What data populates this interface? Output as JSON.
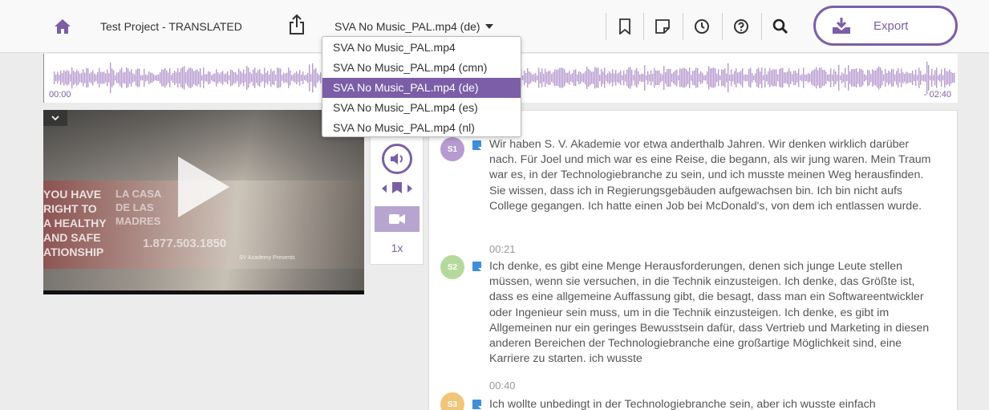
{
  "header": {
    "project_title": "Test Project - TRANSLATED",
    "file_selected": "SVA No Music_PAL.mp4 (de)",
    "export_label": "Export",
    "icons": [
      "home-icon",
      "share-icon",
      "bookmark-icon",
      "note-icon",
      "clock-icon",
      "help-icon",
      "search-icon",
      "download-icon"
    ]
  },
  "dropdown": {
    "options": [
      "SVA No Music_PAL.mp4",
      "SVA No Music_PAL.mp4 (cmn)",
      "SVA No Music_PAL.mp4 (de)",
      "SVA No Music_PAL.mp4 (es)",
      "SVA No Music_PAL.mp4 (nl)"
    ],
    "selected_index": 2
  },
  "waveform": {
    "start_time": "00:00",
    "end_time": "- 02:40",
    "color": "#b79bd0"
  },
  "video": {
    "bus_text": [
      "YOU HAVE",
      "RIGHT TO",
      "A HEALTHY",
      "AND SAFE",
      "ATIONSHIP"
    ],
    "bus_text_2": [
      "LA CASA",
      "DE LAS",
      "MADRES"
    ],
    "phone": "1.877.503.1850",
    "overlay": "SV Academy Presents"
  },
  "controls": {
    "speed": "1x",
    "accent": "#7b5ea7"
  },
  "transcript": {
    "segments": [
      {
        "speaker": "S1",
        "color": "#b79bd0",
        "time": "",
        "text": "Wir haben S. V. Akademie vor etwa anderthalb Jahren. Wir denken wirklich darüber nach. Für Joel und mich war es eine Reise, die begann, als wir jung waren. Mein Traum war es, in der Technologiebranche zu sein, und ich musste meinen Weg herausfinden. Sie wissen, dass ich in Regierungsgebäuden aufgewachsen bin. Ich bin nicht aufs College gegangen. Ich hatte einen Job bei McDonald's, von dem ich entlassen wurde."
      },
      {
        "speaker": "S2",
        "color": "#b5d99c",
        "time": "00:21",
        "text": "Ich denke, es gibt eine Menge Herausforderungen, denen sich junge Leute stellen müssen, wenn sie versuchen, in die Technik einzusteigen. Ich denke, das Größte ist, dass es eine allgemeine Auffassung gibt, die besagt, dass man ein Softwareentwickler oder Ingenieur sein muss, um in die Technik einzusteigen. Ich denke, es gibt im Allgemeinen nur ein geringes Bewusstsein dafür, dass Vertrieb und Marketing in diesen anderen Bereichen der Technologiebranche eine großartige Möglichkeit sind, eine Karriere zu starten. ich wusste"
      },
      {
        "speaker": "S3",
        "color": "#f1c57a",
        "time": "00:40",
        "text": "Ich wollte unbedingt in der Technologiebranche sein, aber ich wusste einfach"
      }
    ]
  }
}
